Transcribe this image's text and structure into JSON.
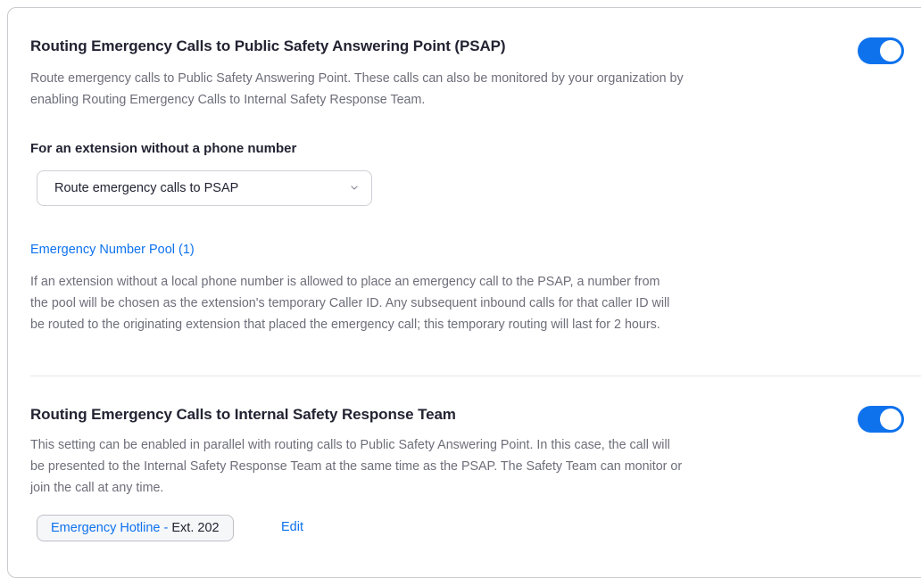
{
  "psap": {
    "title": "Routing Emergency Calls to Public Safety Answering Point (PSAP)",
    "description_line1": "Route emergency calls to Public Safety Answering Point. These calls can also be monitored by your organization by",
    "description_line2": "enabling Routing Emergency Calls to Internal Safety Response Team.",
    "toggle_on": true,
    "extension_heading": "For an extension without a phone number",
    "extension_select_value": "Route emergency calls to PSAP",
    "pool_link": "Emergency Number Pool (1)",
    "pool_desc_line1": "If an extension without a local phone number is allowed to place an emergency call to the PSAP, a number from",
    "pool_desc_line2": "the pool will be chosen as the extension's temporary Caller ID. Any subsequent inbound calls for that caller ID will",
    "pool_desc_line3": "be routed to the originating extension that placed the emergency call; this temporary routing will last for 2 hours."
  },
  "internal": {
    "title": "Routing Emergency Calls to Internal Safety Response Team",
    "description_line1": "This setting can be enabled in parallel with routing calls to Public Safety Answering Point. In this case, the call will",
    "description_line2": "be presented to the Internal Safety Response Team at the same time as the PSAP. The Safety Team can monitor or",
    "description_line3": "join the call at any time.",
    "toggle_on": true,
    "hotline_name": "Emergency Hotline",
    "hotline_sep": " - ",
    "hotline_ext": "Ext. 202",
    "edit_label": "Edit"
  },
  "colors": {
    "accent": "#0e72ed",
    "text": "#232333",
    "muted": "#6e6e7a"
  }
}
